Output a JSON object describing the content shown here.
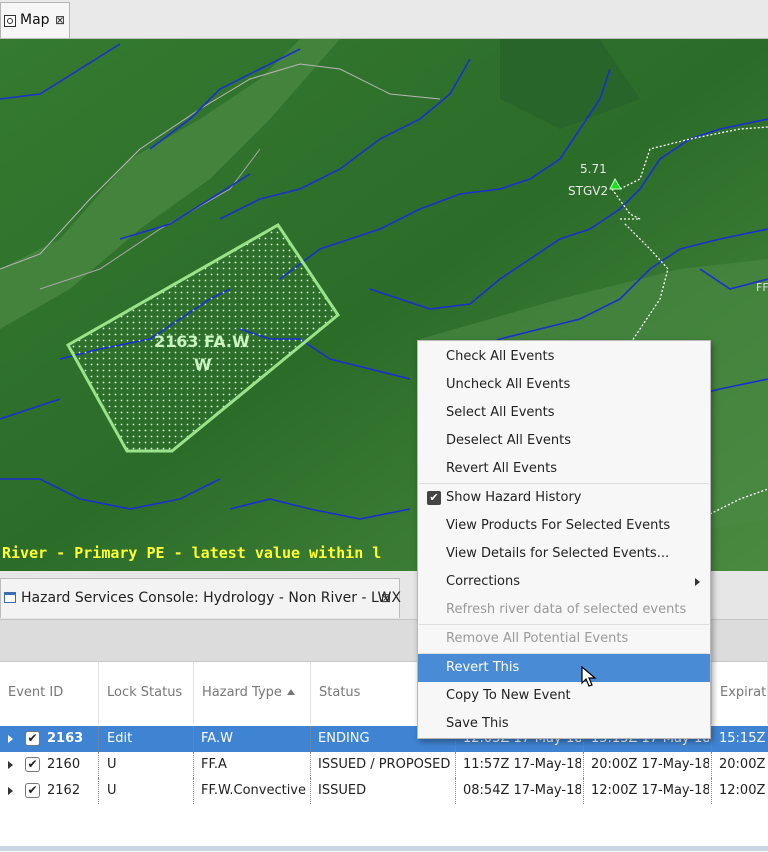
{
  "map_tab": {
    "label": "Map",
    "close": "⊠"
  },
  "map": {
    "hazard_label_line1": "2163 FA.W",
    "hazard_label_line2": "W",
    "gauge_value": "5.71",
    "gauge_id": "STGV2",
    "edge_label": "FF",
    "status_line": "River - Primary PE - latest value within l"
  },
  "console_tab": {
    "label": "Hazard Services Console: Hydrology - Non River - LWX",
    "close": "⊠"
  },
  "table": {
    "columns": [
      "Event ID",
      "Lock Status",
      "Hazard Type",
      "Status",
      "",
      "",
      "Expirati"
    ],
    "rows": [
      {
        "event_id": "2163",
        "lock": "Edit",
        "hazard": "FA.W",
        "status": "ENDING",
        "issue": "12:05Z 17-May-18",
        "end": "15:15Z 17-May-18",
        "expiration": "15:15Z",
        "selected": true,
        "checked": true
      },
      {
        "event_id": "2160",
        "lock": "U",
        "hazard": "FF.A",
        "status": "ISSUED / PROPOSED",
        "issue": "11:57Z 17-May-18",
        "end": "20:00Z 17-May-18",
        "expiration": "20:00Z",
        "selected": false,
        "checked": true
      },
      {
        "event_id": "2162",
        "lock": "U",
        "hazard": "FF.W.Convective",
        "status": "ISSUED",
        "issue": "08:54Z 17-May-18",
        "end": "12:00Z 17-May-18",
        "expiration": "12:00Z",
        "selected": false,
        "checked": true
      }
    ]
  },
  "context_menu": {
    "items": [
      {
        "label": "Check All Events"
      },
      {
        "label": "Uncheck All Events"
      },
      {
        "label": "Select All Events"
      },
      {
        "label": "Deselect All Events"
      },
      {
        "label": "Revert All Events"
      },
      {
        "label": "Show Hazard History"
      },
      {
        "label": "View Products For Selected Events"
      },
      {
        "label": "View Details for Selected Events..."
      },
      {
        "label": "Corrections"
      },
      {
        "label": "Refresh river data of selected events"
      },
      {
        "label": "Remove All Potential Events"
      },
      {
        "label": "Revert This"
      },
      {
        "label": "Copy To New Event"
      },
      {
        "label": "Save This"
      }
    ]
  },
  "colors": {
    "selection": "#3f84d3",
    "menu_highlight": "#4a8bd6",
    "map_green": "#2c6e2a",
    "status_yellow": "#ffff33"
  }
}
